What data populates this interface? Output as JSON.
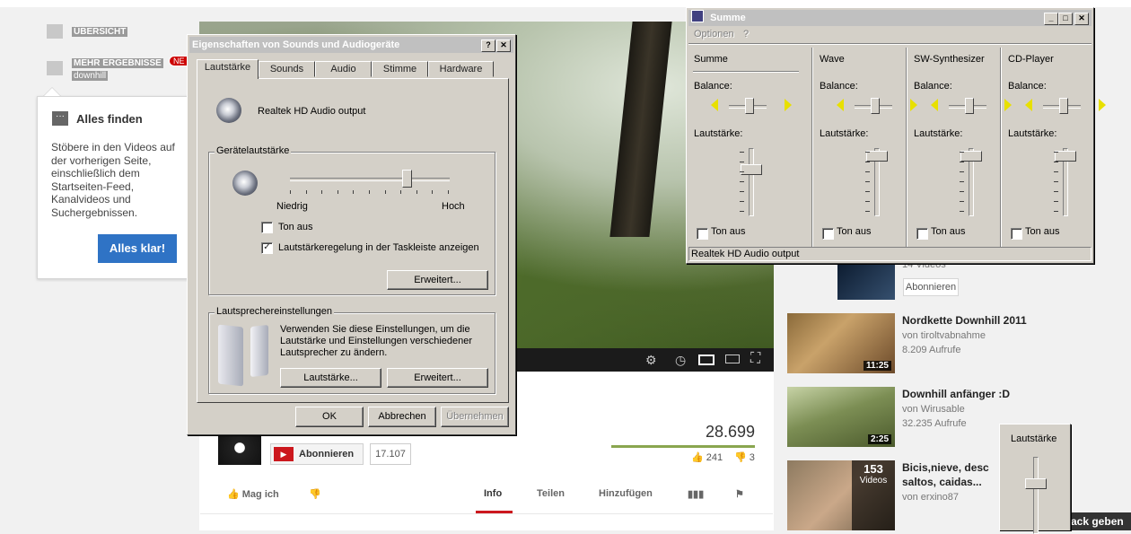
{
  "youtube": {
    "guide": {
      "overview": "ÜBERSICHT",
      "more_results": "MEHR ERGEBNISSE",
      "more_results_sub": "downhill",
      "badge": "NE"
    },
    "tooltip": {
      "title": "Alles finden",
      "text": "Stöbere in den Videos auf der vorherigen Seite, einschließlich dem Startseiten-Feed, Kanalvideos und Suchergebnissen.",
      "button": "Alles klar!"
    },
    "channel": {
      "subscribe_label": "Abonnieren",
      "subscriber_count": "17.107"
    },
    "stats": {
      "views": "28.699",
      "likes": "241",
      "dislikes": "3"
    },
    "actions": {
      "like": "Mag ich",
      "tabs": [
        "Info",
        "Teilen",
        "Hinzufügen"
      ]
    },
    "related": [
      {
        "meta1": "14 Videos",
        "subscribe": "Abonnieren"
      },
      {
        "title": "Nordkette Downhill 2011",
        "author": "von tiroltvabnahme",
        "views": "8.209 Aufrufe",
        "duration": "11:25"
      },
      {
        "title": "Downhill anfänger :D",
        "author": "von Wirusable",
        "views": "32.235 Aufrufe",
        "duration": "2:25"
      },
      {
        "title": "Bicis,nieve, desc",
        "title2": "saltos, caidas...",
        "author": "von erxino87",
        "count": "153",
        "count_label": "Videos"
      }
    ],
    "feedback": "ack geben"
  },
  "sound_dialog": {
    "title": "Eigenschaften von Sounds und Audiogeräte",
    "title_help": "?",
    "title_close": "✕",
    "tabs": [
      "Lautstärke",
      "Sounds",
      "Audio",
      "Stimme",
      "Hardware"
    ],
    "device_name": "Realtek HD Audio output",
    "device_volume_group": "Gerätelautstärke",
    "volume_level": 0.73,
    "low_label": "Niedrig",
    "high_label": "Hoch",
    "mute_label": "Ton aus",
    "mute_checked": false,
    "taskbar_label": "Lautstärkeregelung in der Taskleiste anzeigen",
    "taskbar_checked": true,
    "advanced_button": "Erweitert...",
    "speaker_group": "Lautsprechereinstellungen",
    "speaker_text": "Verwenden Sie diese Einstellungen, um die Lautstärke und Einstellungen verschiedener Lautsprecher zu ändern.",
    "speaker_volume_button": "Lautstärke...",
    "speaker_advanced_button": "Erweitert...",
    "ok": "OK",
    "cancel": "Abbrechen",
    "apply": "Übernehmen"
  },
  "mixer": {
    "title": "Summe",
    "menu": [
      "Optionen",
      "?"
    ],
    "balance_label": "Balance:",
    "volume_label": "Lautstärke:",
    "mute_label": "Ton aus",
    "channels": [
      {
        "name": "Summe",
        "volume": 0.72,
        "balance": 0.5
      },
      {
        "name": "Wave",
        "volume": 0.95,
        "balance": 0.5
      },
      {
        "name": "SW-Synthesizer",
        "volume": 0.95,
        "balance": 0.5
      },
      {
        "name": "CD-Player",
        "volume": 0.95,
        "balance": 0.5
      }
    ],
    "status": "Realtek HD Audio output"
  },
  "tray_volume": {
    "title": "Lautstärke",
    "volume": 0.68
  }
}
